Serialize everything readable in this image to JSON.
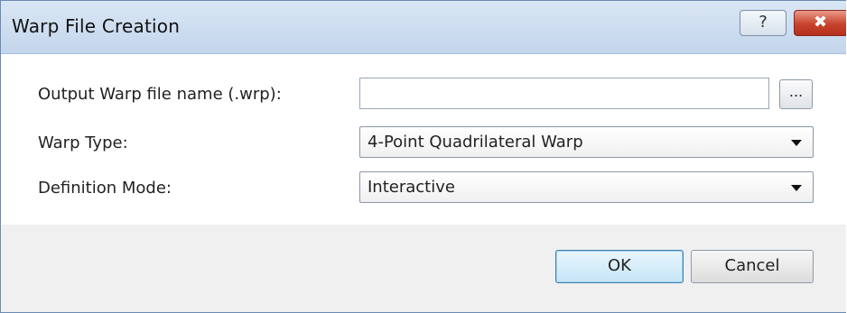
{
  "window": {
    "title": "Warp File Creation",
    "help_label": "?",
    "close_label": "✖"
  },
  "form": {
    "output_label": "Output Warp file name (.wrp):",
    "output_value": "",
    "browse_label": "...",
    "warp_type_label": "Warp Type:",
    "warp_type_value": "4-Point Quadrilateral Warp",
    "definition_mode_label": "Definition Mode:",
    "definition_mode_value": "Interactive"
  },
  "buttons": {
    "ok": "OK",
    "cancel": "Cancel"
  },
  "colors": {
    "titlebar": "#c9d9ee",
    "close_button": "#c8432d",
    "default_button": "#c4e5f6"
  }
}
